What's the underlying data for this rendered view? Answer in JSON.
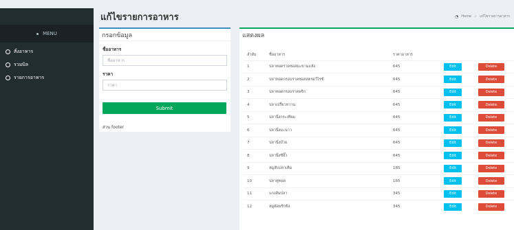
{
  "header": {
    "title": "แก้ไขรายการอาหาร"
  },
  "breadcrumb": {
    "home": "Home",
    "current": "แก้ไขรายการอาหาร"
  },
  "sidebar": {
    "menu_label": "MENU",
    "items": [
      {
        "label": "สั่งอาหาร"
      },
      {
        "label": "รวมบิล"
      },
      {
        "label": "รายการอาหาร"
      }
    ]
  },
  "form": {
    "title": "กรอกข้อมูล",
    "name_label": "ชื่ออาหาร",
    "name_placeholder": "ชื่ออาหาร",
    "price_label": "ราคา",
    "price_placeholder": "ราคา",
    "submit_label": "Submit",
    "footer": "ส่วน footer"
  },
  "results": {
    "title": "แสดงผล",
    "columns": [
      "ลำดับ",
      "ชื่ออาหาร",
      "ราคาอาหาร"
    ],
    "edit_label": "Edit",
    "delete_label": "Delete",
    "rows": [
      {
        "no": "1",
        "name": "ปลาทอดราดซอสมะขามแห้ง",
        "price": "645"
      },
      {
        "no": "2",
        "name": "ปลาทอดกรอบราดซอสสตรอว์ไรซ์",
        "price": "645"
      },
      {
        "no": "3",
        "name": "ปลาทอดกรอบราดพริก",
        "price": "645"
      },
      {
        "no": "4",
        "name": "ปลาเปรี้ยวหวาน",
        "price": "645"
      },
      {
        "no": "5",
        "name": "ปลานึ่งกระเทียม",
        "price": "645"
      },
      {
        "no": "6",
        "name": "ปลานึ่งมะนาว",
        "price": "645"
      },
      {
        "no": "7",
        "name": "ปลานึ่งบ๊วย",
        "price": "645"
      },
      {
        "no": "8",
        "name": "ปลานึ่งซีอิ๊ว",
        "price": "645"
      },
      {
        "no": "9",
        "name": "หมูสับปลาเค็ม",
        "price": "185"
      },
      {
        "no": "10",
        "name": "ปลาทูทอด",
        "price": "165"
      },
      {
        "no": "11",
        "name": "แกงส้มปลา",
        "price": "345"
      },
      {
        "no": "12",
        "name": "หมูผัดพริกขิง",
        "price": "345"
      }
    ]
  },
  "colors": {
    "sidebar_bg": "#222d32",
    "submit_green": "#00a65a",
    "edit_blue": "#00c0ef",
    "delete_red": "#dd4b39"
  }
}
